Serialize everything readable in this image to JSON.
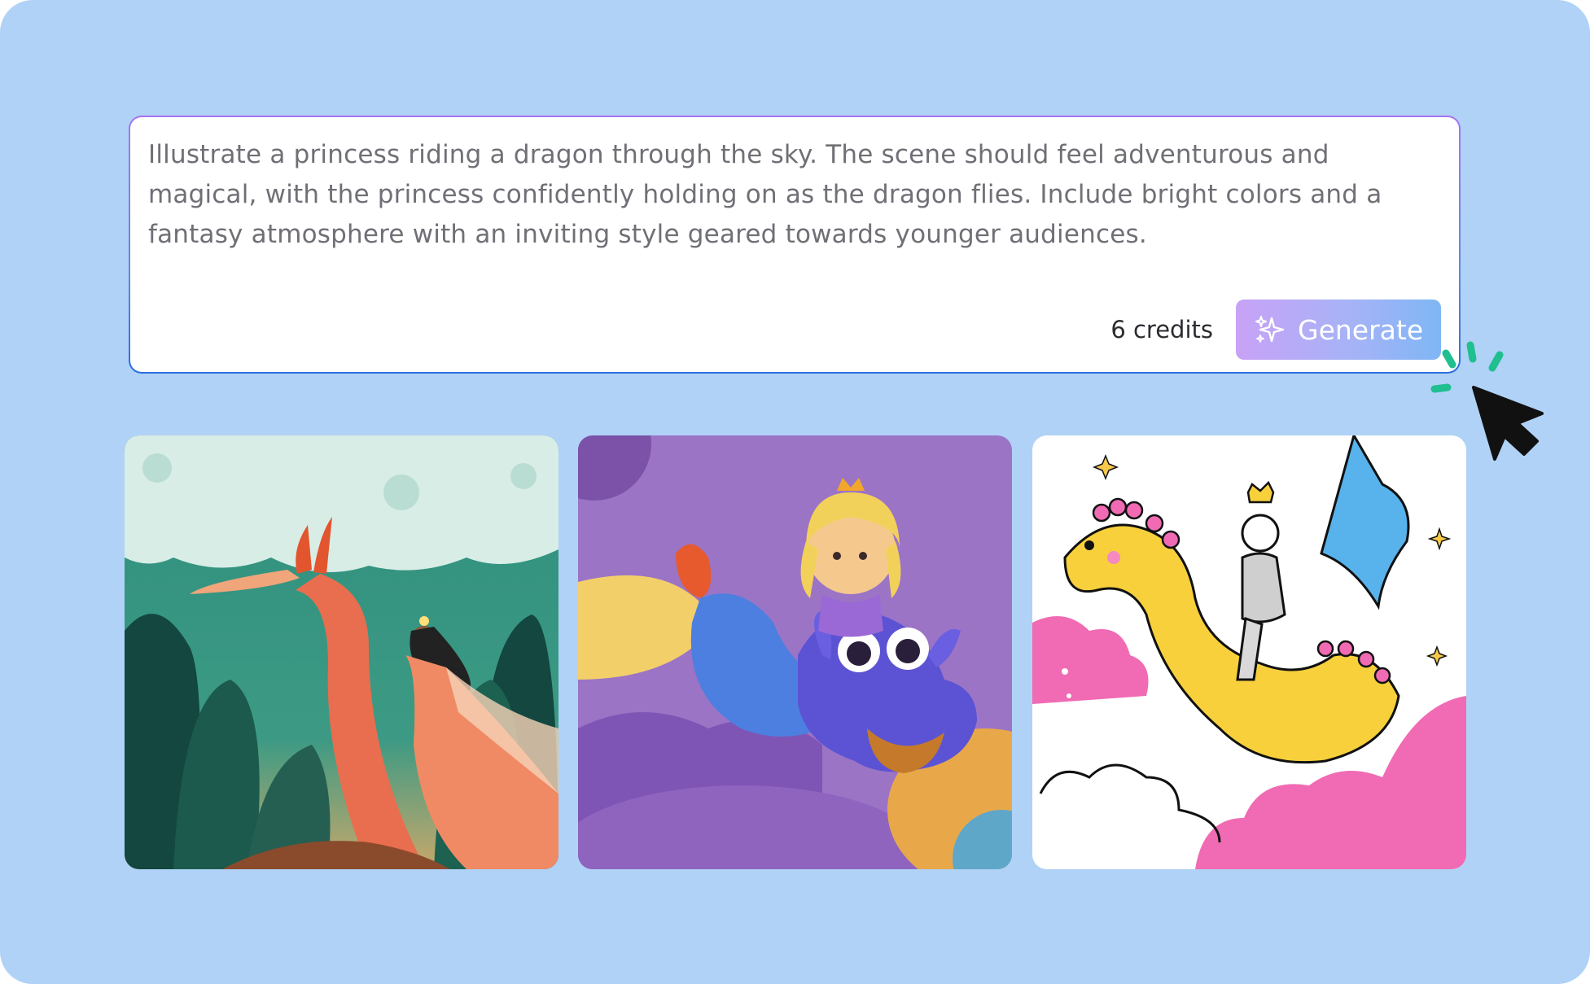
{
  "prompt": {
    "text": "Illustrate a princess riding a dragon through the sky. The scene should feel adventurous and magical, with the princess confidently holding on as the dragon flies. Include bright colors and a fantasy atmosphere with an inviting style geared towards younger audiences."
  },
  "actions": {
    "credits_label": "6 credits",
    "generate_label": "Generate",
    "generate_icon": "sparkles-icon"
  },
  "results": [
    {
      "style": "storybook-illustration",
      "subject": "princess riding dragon"
    },
    {
      "style": "3d-clay-render",
      "subject": "princess riding dragon"
    },
    {
      "style": "line-art-coloring",
      "subject": "knight princess riding dragon"
    }
  ],
  "colors": {
    "background": "#b0d2f6",
    "accent_start": "#c8a2f6",
    "accent_end": "#7fb6f5",
    "click_burst": "#1fbf8f"
  }
}
